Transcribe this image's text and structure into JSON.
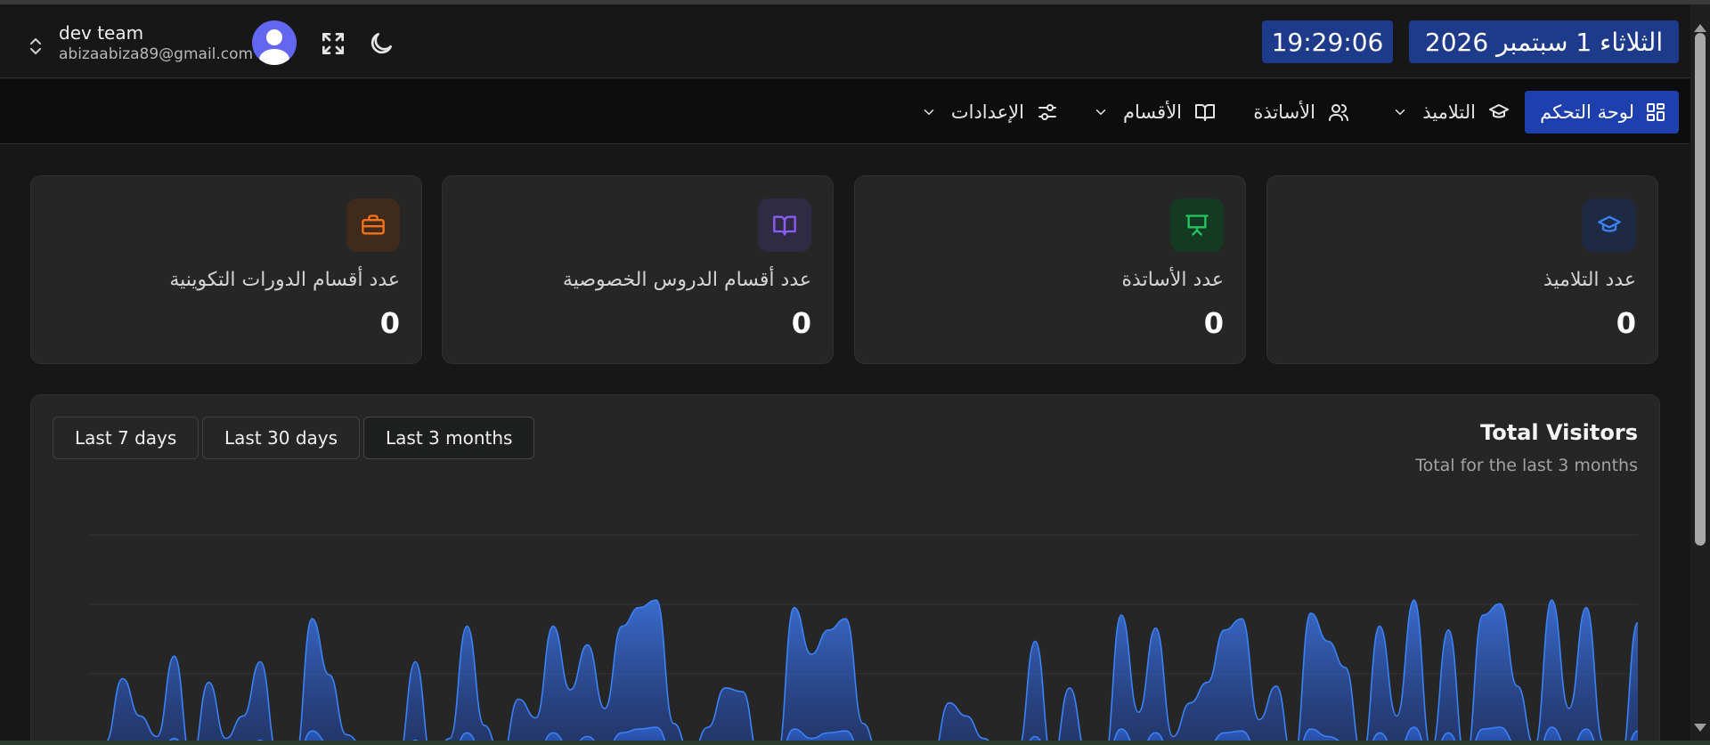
{
  "header": {
    "user_name": "dev team",
    "user_email": "abizaabiza89@gmail.com",
    "date": "الثلاثاء 1 سبتمبر 2026",
    "time": "19:29:06",
    "icons": {
      "toggle": "chevrons-up-down-icon",
      "fullscreen": "fullscreen-icon",
      "theme": "moon-icon"
    }
  },
  "nav": {
    "items": [
      {
        "label": "لوحة التحكم",
        "icon": "dashboard-icon"
      },
      {
        "label": "التلاميذ",
        "icon": "graduation-cap-icon"
      },
      {
        "label": "الأساتذة",
        "icon": "users-icon"
      },
      {
        "label": "الأقسام",
        "icon": "book-open-icon"
      },
      {
        "label": "الإعدادات",
        "icon": "sliders-icon"
      }
    ]
  },
  "cards": [
    {
      "label": "عدد التلاميذ",
      "value": "0",
      "icon": "graduation-cap-icon",
      "color": "#3b82f6"
    },
    {
      "label": "عدد الأساتذة",
      "value": "0",
      "icon": "presentation-icon",
      "color": "#22c55e"
    },
    {
      "label": "عدد أقسام الدروس الخصوصية",
      "value": "0",
      "icon": "book-open-icon",
      "color": "#8b5cf6"
    },
    {
      "label": "عدد أقسام الدورات التكوينية",
      "value": "0",
      "icon": "briefcase-icon",
      "color": "#f97316"
    }
  ],
  "visitors": {
    "title": "Total Visitors",
    "subtitle": "Total for the last 3 months",
    "ranges": [
      "Last 7 days",
      "Last 30 days",
      "Last 3 months"
    ],
    "selected_range": "Last 3 months"
  },
  "chart_data": {
    "type": "area",
    "colors": {
      "stroke": "#3b82f6",
      "fill": "#1d4ed8"
    },
    "grid": true,
    "series": [
      {
        "values": [
          0.05,
          0.12,
          0.46,
          0.26,
          0.15,
          0.58,
          0.02,
          0.44,
          0.14,
          0.26,
          0.55,
          0.06,
          0.02,
          0.78,
          0.48,
          0.16,
          0.1,
          0.02,
          0.03,
          0.55,
          0.01,
          0.14,
          0.74,
          0.21,
          0.04,
          0.35,
          0.25,
          0.74,
          0.4,
          0.64,
          0.3,
          0.74,
          0.84,
          0.88,
          0.22,
          0.05,
          0.2,
          0.41,
          0.39,
          0.03,
          0.04,
          0.84,
          0.59,
          0.72,
          0.78,
          0.22,
          0.03,
          0.06,
          0.03,
          0.03,
          0.33,
          0.26,
          0.14,
          0.05,
          0.08,
          0.66,
          0.02,
          0.41,
          0.06,
          0.02,
          0.8,
          0.28,
          0.73,
          0.15,
          0.33,
          0.44,
          0.72,
          0.78,
          0.24,
          0.42,
          0.01,
          0.81,
          0.66,
          0.52,
          0.04,
          0.74,
          0.26,
          0.88,
          0.08,
          0.72,
          0.02,
          0.8,
          0.86,
          0.42,
          0.1,
          0.88,
          0.3,
          0.84,
          0.12,
          0.02,
          0.76
        ]
      },
      {
        "values": [
          0.01,
          0.02,
          0.12,
          0.06,
          0.03,
          0.14,
          0.01,
          0.1,
          0.03,
          0.06,
          0.13,
          0.01,
          0.01,
          0.18,
          0.11,
          0.04,
          0.02,
          0.01,
          0.01,
          0.13,
          0.0,
          0.03,
          0.17,
          0.05,
          0.01,
          0.08,
          0.06,
          0.17,
          0.09,
          0.15,
          0.07,
          0.17,
          0.19,
          0.2,
          0.05,
          0.01,
          0.05,
          0.1,
          0.09,
          0.01,
          0.01,
          0.19,
          0.14,
          0.17,
          0.18,
          0.05,
          0.01,
          0.01,
          0.01,
          0.01,
          0.08,
          0.06,
          0.03,
          0.01,
          0.02,
          0.15,
          0.0,
          0.1,
          0.01,
          0.0,
          0.19,
          0.07,
          0.17,
          0.04,
          0.08,
          0.1,
          0.17,
          0.18,
          0.06,
          0.1,
          0.0,
          0.19,
          0.15,
          0.12,
          0.01,
          0.17,
          0.06,
          0.2,
          0.02,
          0.17,
          0.0,
          0.19,
          0.2,
          0.1,
          0.02,
          0.2,
          0.07,
          0.19,
          0.03,
          0.0,
          0.18
        ]
      }
    ]
  }
}
